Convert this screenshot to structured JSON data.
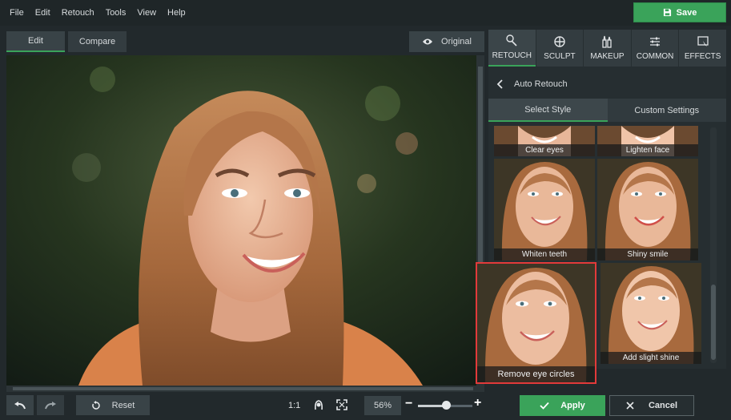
{
  "menu": {
    "items": [
      "File",
      "Edit",
      "Retouch",
      "Tools",
      "View",
      "Help"
    ]
  },
  "header": {
    "save_label": "Save"
  },
  "viewbar": {
    "edit_tab": "Edit",
    "compare_tab": "Compare",
    "original_label": "Original"
  },
  "tools": {
    "items": [
      {
        "label": "RETOUCH",
        "icon": "retouch-icon"
      },
      {
        "label": "SCULPT",
        "icon": "sculpt-icon"
      },
      {
        "label": "MAKEUP",
        "icon": "makeup-icon"
      },
      {
        "label": "COMMON",
        "icon": "sliders-icon"
      },
      {
        "label": "EFFECTS",
        "icon": "effects-icon"
      }
    ],
    "active": "RETOUCH"
  },
  "panel": {
    "breadcrumb": "Auto Retouch",
    "subtabs": [
      "Select Style",
      "Custom Settings"
    ],
    "active_subtab": "Select Style",
    "styles": [
      "Clear eyes",
      "Lighten face",
      "Whiten teeth",
      "Shiny smile",
      "Remove eye circles",
      "Add slight shine"
    ],
    "selected_style": "Remove eye circles"
  },
  "bottom": {
    "reset_label": "Reset",
    "ratio_label": "1:1",
    "zoom_value": "56%",
    "zoom_slider_fraction": 0.52,
    "apply_label": "Apply",
    "cancel_label": "Cancel"
  },
  "colors": {
    "accent": "#3aa35a",
    "selected_border": "#e23a3a",
    "background": "#22292c"
  }
}
